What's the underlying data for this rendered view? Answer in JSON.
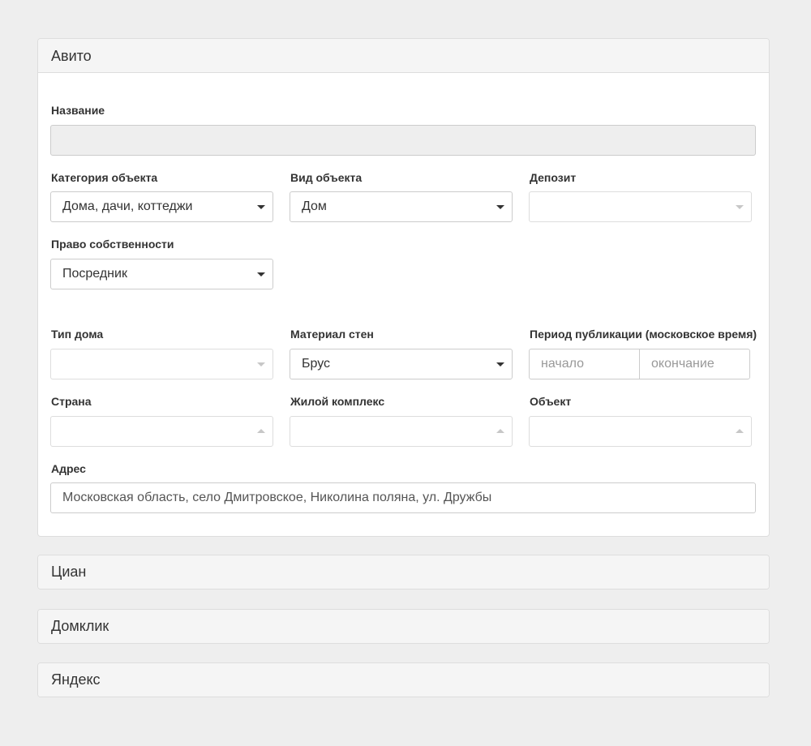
{
  "panels": {
    "avito": {
      "title": "Авито"
    },
    "cian": {
      "title": "Циан"
    },
    "domclick": {
      "title": "Домклик"
    },
    "yandex": {
      "title": "Яндекс"
    }
  },
  "form": {
    "name": {
      "label": "Название",
      "value": ""
    },
    "category": {
      "label": "Категория объекта",
      "value": "Дома, дачи, коттеджи"
    },
    "object_type": {
      "label": "Вид объекта",
      "value": "Дом"
    },
    "deposit": {
      "label": "Депозит",
      "value": ""
    },
    "ownership": {
      "label": "Право собственности",
      "value": "Посредник"
    },
    "house_type": {
      "label": "Тип дома",
      "value": ""
    },
    "wall_material": {
      "label": "Материал стен",
      "value": "Брус"
    },
    "publication_period": {
      "label": "Период публикации (московское время)",
      "start_placeholder": "начало",
      "end_placeholder": "окончание"
    },
    "country": {
      "label": "Страна",
      "value": ""
    },
    "residential_complex": {
      "label": "Жилой комплекс",
      "value": ""
    },
    "object": {
      "label": "Объект",
      "value": ""
    },
    "address": {
      "label": "Адрес",
      "value": "Московская область, село Дмитровское, Николина поляна, ул. Дружбы"
    }
  }
}
